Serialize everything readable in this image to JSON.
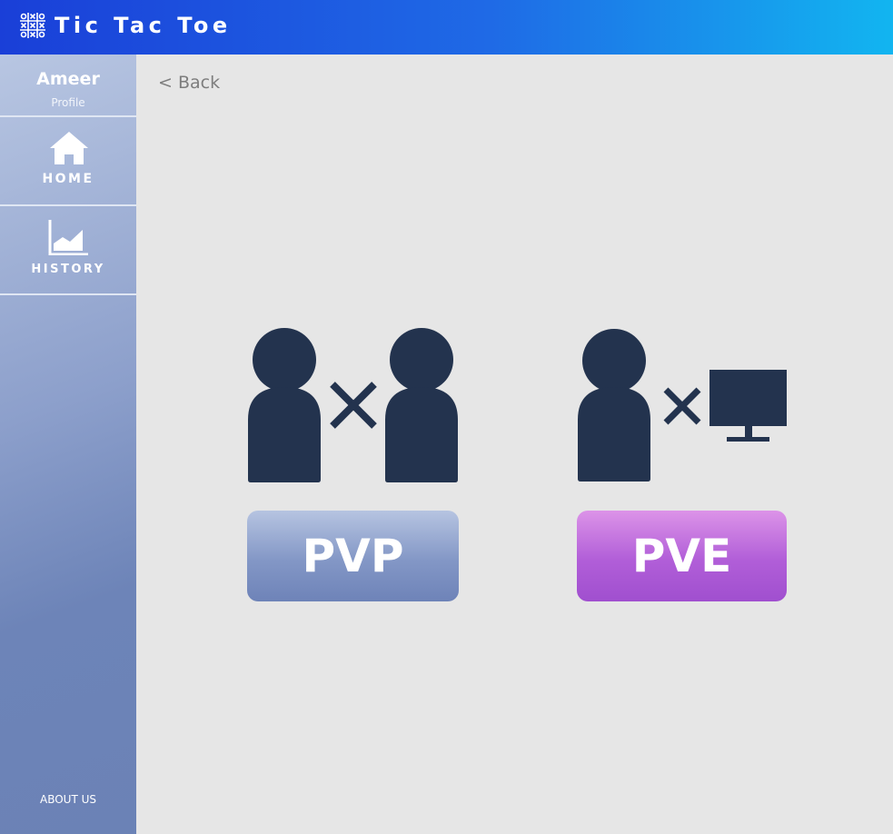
{
  "header": {
    "title": "Tic Tac Toe",
    "logo_icon": "tic-tac-toe-grid-icon"
  },
  "sidebar": {
    "profile": {
      "name": "Ameer",
      "sublabel": "Profile"
    },
    "items": [
      {
        "label": "HOME",
        "icon": "home-icon"
      },
      {
        "label": "HISTORY",
        "icon": "chart-icon"
      }
    ],
    "footer_link": "ABOUT US"
  },
  "main": {
    "back_label": "< Back",
    "modes": [
      {
        "label": "PVP",
        "icon": "player-vs-player-icon"
      },
      {
        "label": "PVE",
        "icon": "player-vs-computer-icon"
      }
    ]
  },
  "colors": {
    "header_start": "#1a3fd8",
    "header_end": "#12b5f0",
    "sidebar": "#6b82b6",
    "background": "#e6e6e6",
    "silhouette": "#23334e",
    "pvp_button": "#6e83b8",
    "pve_button": "#a04fcf"
  }
}
